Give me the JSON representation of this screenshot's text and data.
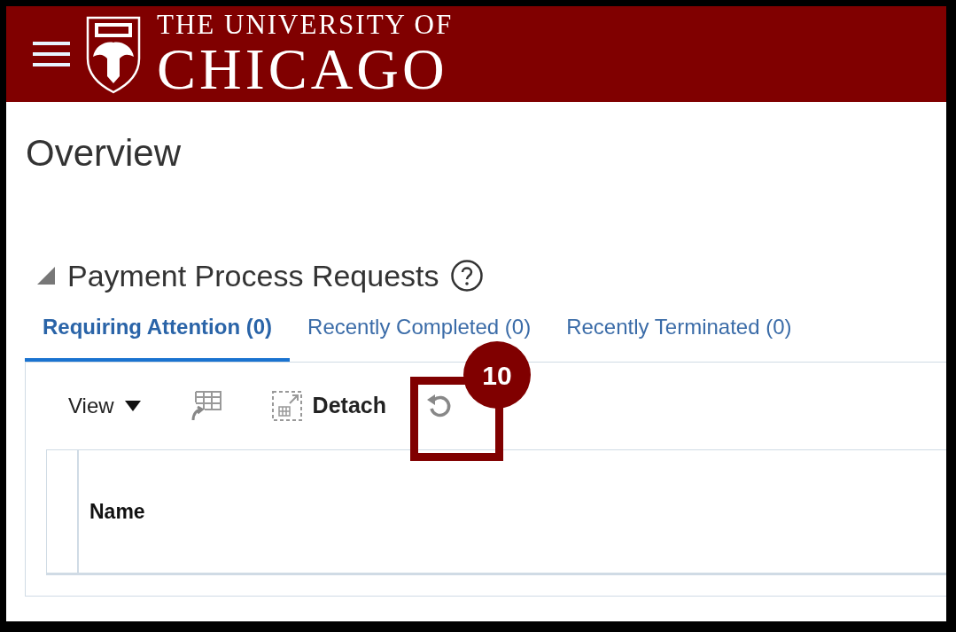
{
  "header": {
    "logo_line_1": "THE UNIVERSITY OF",
    "logo_line_2": "CHICAGO"
  },
  "page_title": "Overview",
  "section": {
    "title": "Payment Process Requests",
    "expanded": true
  },
  "tabs": [
    {
      "label": "Requiring Attention (0)",
      "selected": true
    },
    {
      "label": "Recently Completed (0)",
      "selected": false
    },
    {
      "label": "Recently Terminated (0)",
      "selected": false
    }
  ],
  "toolbar": {
    "view_label": "View",
    "detach_label": "Detach"
  },
  "table": {
    "columns": [
      "Name"
    ]
  },
  "callout": {
    "number": "10"
  }
}
